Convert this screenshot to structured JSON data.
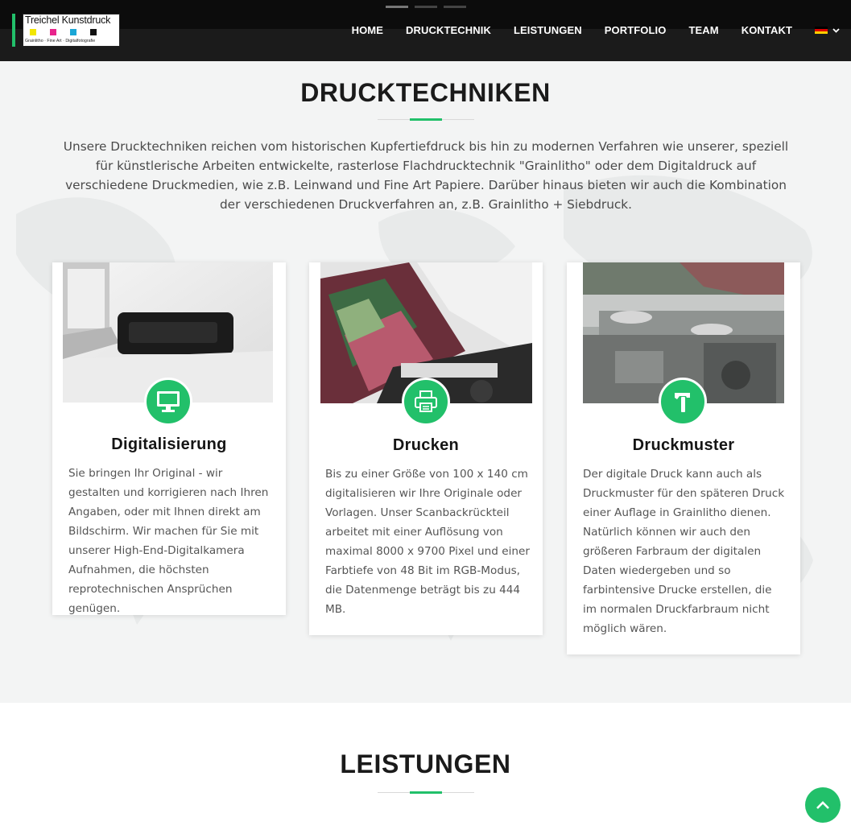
{
  "header": {
    "logo": {
      "title": "Treichel Kunstdruck",
      "subtitle": "Grainlitho · Fine Art · Digitalfotografie",
      "square_colors": [
        "#f2e600",
        "#e8248c",
        "#1aa6d6",
        "#111111"
      ]
    },
    "nav": [
      "HOME",
      "DRUCKTECHNIK",
      "LEISTUNGEN",
      "PORTFOLIO",
      "TEAM",
      "KONTAKT"
    ],
    "language_flag": [
      "#000000",
      "#dd0000",
      "#ffce00"
    ]
  },
  "drucktechniken": {
    "title": "DRUCKTECHNIKEN",
    "intro": "Unsere Drucktechniken reichen vom historischen Kupfertiefdruck bis hin zu modernen Verfahren wie unserer, speziell für künstlerische Arbeiten entwickelte, rasterlose Flachdrucktechnik \"Grainlitho\" oder dem Digitaldruck auf verschiedene Druckmedien, wie z.B. Leinwand und Fine Art Papiere. Darüber hinaus bieten wir auch die Kombination der verschiedenen Druckverfahren an, z.B. Grainlitho + Siebdruck.",
    "cards": [
      {
        "icon": "monitor-icon",
        "title": "Digitalisierung",
        "text": "Sie bringen Ihr Original - wir gestalten und korrigieren nach Ihren Angaben, oder mit Ihnen direkt am Bildschirm. Wir machen für Sie mit unserer High-End-Digitalkamera Aufnahmen, die höchsten reprotechnischen Ansprüchen genügen."
      },
      {
        "icon": "printer-icon",
        "title": "Drucken",
        "text": "Bis zu einer Größe von 100 x 140 cm digitalisieren wir Ihre Originale oder Vorlagen. Unser Scanbackrückteil arbeitet mit einer Auflösung von maximal 8000 x 9700 Pixel und einer Farbtiefe von 48 Bit im RGB-Modus, die Datenmenge beträgt bis zu 444 MB."
      },
      {
        "icon": "hammer-icon",
        "title": "Druckmuster",
        "text": "Der digitale Druck kann auch als Druckmuster für den späteren Druck einer Auflage in Grainlitho dienen. Natürlich können wir auch den größeren Farbraum der digitalen Daten wiedergeben und so farbintensive Drucke erstellen, die im normalen Druckfarbraum nicht möglich wären."
      }
    ]
  },
  "leistungen": {
    "title": "LEISTUNGEN"
  },
  "colors": {
    "accent": "#22c06a",
    "header": "#1b1b1b"
  }
}
